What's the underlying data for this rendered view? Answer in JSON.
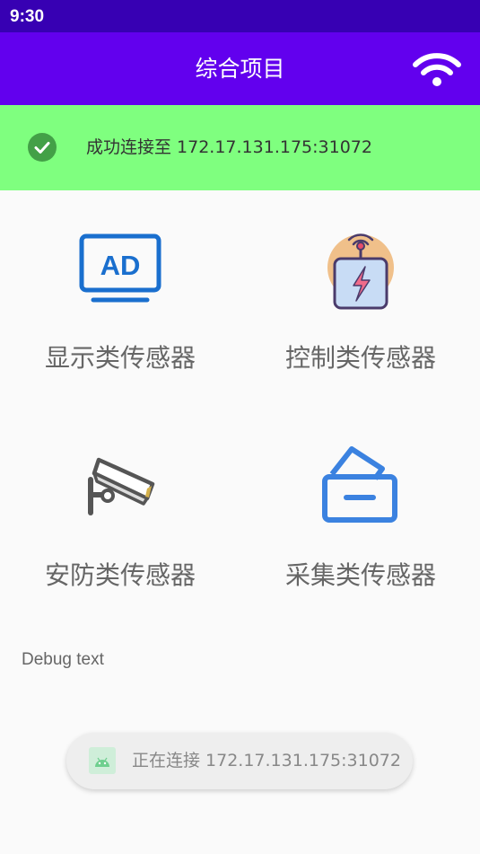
{
  "status_bar": {
    "time": "9:30"
  },
  "app_bar": {
    "title": "综合项目",
    "wifi_icon": "wifi-icon"
  },
  "banner": {
    "icon": "check-circle-icon",
    "text": "成功连接至 172.17.131.175:31072",
    "background": "#7fff7f"
  },
  "tiles": [
    {
      "label": "显示类传感器",
      "icon": "ad-display-icon"
    },
    {
      "label": "控制类传感器",
      "icon": "power-device-icon"
    },
    {
      "label": "安防类传感器",
      "icon": "security-camera-icon"
    },
    {
      "label": "采集类传感器",
      "icon": "collection-box-icon"
    }
  ],
  "debug_text": "Debug text",
  "toast": {
    "icon": "android-app-icon",
    "text": "正在连接 172.17.131.175:31072"
  },
  "colors": {
    "status_bar": "#3700b3",
    "app_bar": "#6200ee",
    "accent_blue": "#1a6fce"
  }
}
